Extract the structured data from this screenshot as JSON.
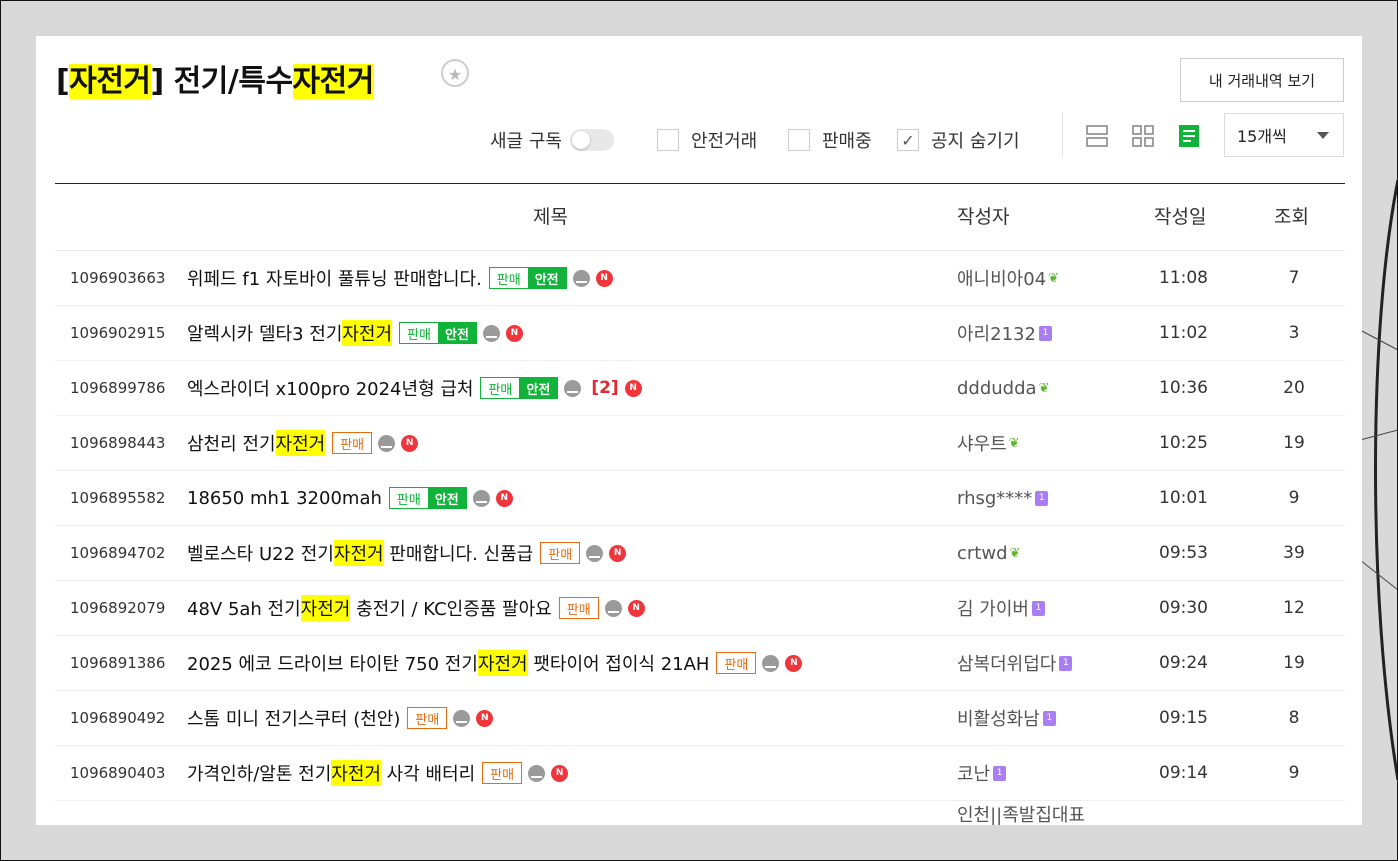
{
  "board": {
    "title_bracket_open": "[",
    "title_hl1": "자전거",
    "title_mid": "] 전기/특수",
    "title_hl2": "자전거",
    "star": "★",
    "history_button": "내 거래내역 보기"
  },
  "controls": {
    "subscribe_label": "새글 구독",
    "safe_trade_label": "안전거래",
    "selling_label": "판매중",
    "hide_notice_label": "공지 숨기기",
    "hide_notice_checked": true,
    "per_page": "15개씩"
  },
  "columns": {
    "title": "제목",
    "author": "작성자",
    "date": "작성일",
    "views": "조회"
  },
  "badges": {
    "sell": "판매",
    "safe": "안전"
  },
  "colors": {
    "highlight": "#ffff00",
    "sell": "#e86b0f",
    "safe": "#12b33a",
    "new": "#f0353b",
    "level": "#a97ef2",
    "sprout": "#5ab82a"
  },
  "rows": [
    {
      "num": "1096903663",
      "t1": "위페드 f1 자토바이 풀튜닝 판매합니다.",
      "author": "애니비아04",
      "level": "sprout",
      "date": "11:08",
      "views": "7"
    },
    {
      "num": "1096902915",
      "t1": "알렉시카 델타3 전기",
      "hl": "자전거",
      "author": "아리2132",
      "level": "1",
      "date": "11:02",
      "views": "3"
    },
    {
      "num": "1096899786",
      "t1": "엑스라이더 x100pro 2024년형 급처",
      "comments": "[2]",
      "author": "dddudda",
      "level": "sprout",
      "date": "10:36",
      "views": "20"
    },
    {
      "num": "1096898443",
      "t1": "삼천리 전기",
      "hl": "자전거",
      "author": "샤우트",
      "level": "sprout",
      "date": "10:25",
      "views": "19"
    },
    {
      "num": "1096895582",
      "t1": "18650 mh1 3200mah",
      "author": "rhsg****",
      "level": "1",
      "date": "10:01",
      "views": "9"
    },
    {
      "num": "1096894702",
      "t1": "벨로스타 U22 전기",
      "hl": "자전거",
      "t2": " 판매합니다. 신품급",
      "author": "crtwd",
      "level": "sprout",
      "date": "09:53",
      "views": "39"
    },
    {
      "num": "1096892079",
      "t1": "48V 5ah 전기",
      "hl": "자전거",
      "t2": " 충전기 / KC인증품 팔아요",
      "author": "김 가이버",
      "level": "1",
      "date": "09:30",
      "views": "12"
    },
    {
      "num": "1096891386",
      "t1": "2025 에코 드라이브 타이탄 750 전기",
      "hl": "자전거",
      "t2": " 팻타이어 접이식 21AH",
      "author": "삼복더위덥다",
      "level": "1",
      "date": "09:24",
      "views": "19"
    },
    {
      "num": "1096890492",
      "t1": "스톰 미니 전기스쿠터 (천안)",
      "author": "비활성화남",
      "level": "1",
      "date": "09:15",
      "views": "8"
    },
    {
      "num": "1096890403",
      "t1": "가격인하/알톤 전기",
      "hl": "자전거",
      "t2": " 사각 배터리",
      "author": "코난",
      "level": "1",
      "date": "09:14",
      "views": "9"
    },
    {
      "author": "인천||족발집대표"
    }
  ]
}
